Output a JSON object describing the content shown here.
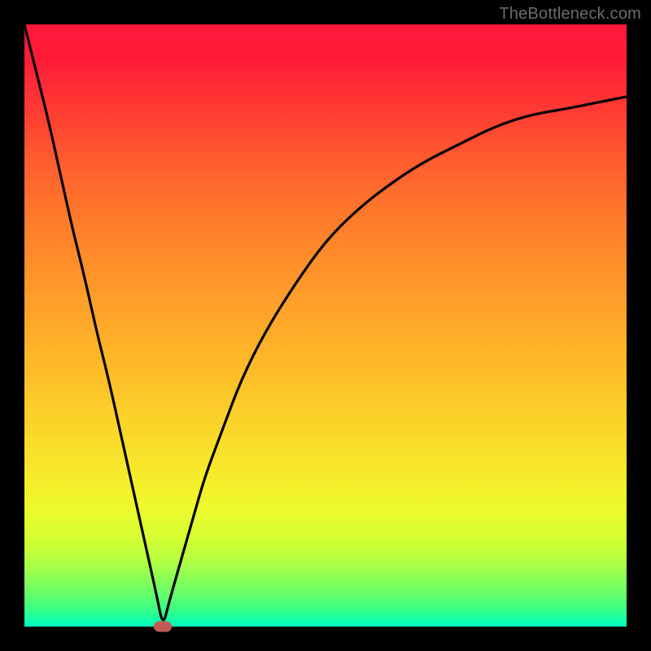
{
  "watermark": "TheBottleneck.com",
  "colors": {
    "curve_stroke": "#000000",
    "marker_fill": "#c45a56"
  },
  "chart_data": {
    "type": "line",
    "title": "",
    "xlabel": "",
    "ylabel": "",
    "xlim": [
      0,
      100
    ],
    "ylim": [
      0,
      100
    ],
    "grid": false,
    "series": [
      {
        "name": "bottleneck-curve",
        "x": [
          0,
          2,
          4,
          6,
          8,
          10,
          12,
          14,
          16,
          18,
          20,
          22,
          23,
          24,
          26,
          28,
          30,
          33,
          36,
          40,
          45,
          50,
          55,
          60,
          66,
          72,
          78,
          84,
          90,
          95,
          100
        ],
        "values": [
          100,
          92,
          84,
          75,
          66,
          58,
          49,
          41,
          32,
          23,
          14,
          5,
          0,
          4,
          11,
          18,
          25,
          33,
          41,
          49,
          57,
          64,
          69,
          73,
          77,
          80,
          83,
          85,
          86,
          87,
          88
        ]
      }
    ],
    "annotations": [
      {
        "name": "minimum-marker",
        "x": 23,
        "y": 0
      }
    ]
  }
}
